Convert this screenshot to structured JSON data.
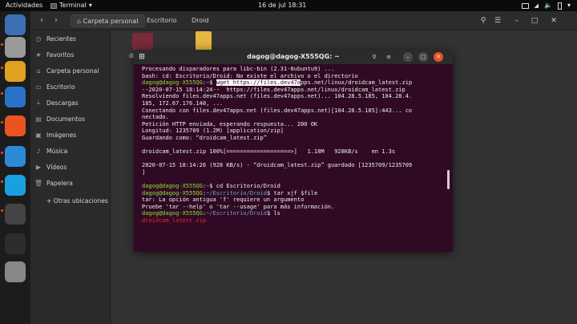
{
  "topbar": {
    "activities": "Actividades",
    "app": "Terminal",
    "clock": "16 de jul  18:31"
  },
  "dock": {
    "items": [
      {
        "name": "thunderbird-icon",
        "color": "#3d6fb5"
      },
      {
        "name": "files-icon",
        "color": "#9a9a9a"
      },
      {
        "name": "rhythmbox-icon",
        "color": "#e0a020"
      },
      {
        "name": "libreoffice-writer-icon",
        "color": "#2a72c8"
      },
      {
        "name": "ubuntu-software-icon",
        "color": "#e95420"
      },
      {
        "name": "help-icon",
        "color": "#2c8ad6"
      },
      {
        "name": "skype-icon",
        "color": "#1a9fe0"
      },
      {
        "name": "webcam-icon",
        "color": "#444444"
      },
      {
        "name": "terminal-icon",
        "color": "#2d2d2d"
      },
      {
        "name": "drive-icon",
        "color": "#888888"
      }
    ]
  },
  "fileManager": {
    "breadcrumbs": [
      "Carpeta personal",
      "Escritorio",
      "Droid"
    ],
    "sidebar": [
      "Recientes",
      "Favoritos",
      "Carpeta personal",
      "Escritorio",
      "Descargas",
      "Documentos",
      "Imágenes",
      "Música",
      "Vídeos",
      "Papelera",
      "+ Otras ubicaciones"
    ],
    "items": [
      {
        "label": "droi"
      }
    ]
  },
  "terminal": {
    "title": "dagog@dagog-X555QG: ~",
    "lines": [
      {
        "parts": [
          {
            "t": "Procesando disparadores para libc-bin (2.31-0ubuntu9) ..."
          }
        ]
      },
      {
        "parts": [
          {
            "t": "bash: cd: Escritorio/Droid: No existe el archivo o el directorio"
          }
        ]
      },
      {
        "parts": [
          {
            "t": "dagog@dagog-X555QG",
            "c": "pu"
          },
          {
            "t": ":"
          },
          {
            "t": "~",
            "c": "pp"
          },
          {
            "t": "$ "
          },
          {
            "t": "wget https://files.dev47a",
            "c": "hl"
          },
          {
            "t": "pps.net/linux/droidcam_latest.zip"
          }
        ]
      },
      {
        "parts": [
          {
            "t": "--2020-07-15 18:14:24--  https://files.dev47apps.net/linux/droidcam_latest.zip"
          }
        ]
      },
      {
        "parts": [
          {
            "t": "Resolviendo files.dev47apps.net (files.dev47apps.net)... 104.28.5.185, 104.28.4."
          }
        ]
      },
      {
        "parts": [
          {
            "t": "185, 172.67.176.140, ..."
          }
        ]
      },
      {
        "parts": [
          {
            "t": "Conectando con files.dev47apps.net (files.dev47apps.net)[104.28.5.185]:443... co"
          }
        ]
      },
      {
        "parts": [
          {
            "t": "nectado."
          }
        ]
      },
      {
        "parts": [
          {
            "t": "Petición HTTP enviada, esperando respuesta... 200 OK"
          }
        ]
      },
      {
        "parts": [
          {
            "t": "Longitud: 1235709 (1.2M) [application/zip]"
          }
        ]
      },
      {
        "parts": [
          {
            "t": "Guardando como: “droidcam_latest.zip”"
          }
        ]
      },
      {
        "parts": [
          {
            "t": ""
          }
        ]
      },
      {
        "parts": [
          {
            "t": "droidcam_latest.zip 100%[===================>]   1.18M   928KB/s    en 1.3s"
          }
        ]
      },
      {
        "parts": [
          {
            "t": ""
          }
        ]
      },
      {
        "parts": [
          {
            "t": "2020-07-15 18:14:26 (928 KB/s) - “droidcam_latest.zip” guardado [1235709/1235709"
          }
        ]
      },
      {
        "parts": [
          {
            "t": "]"
          }
        ]
      },
      {
        "parts": [
          {
            "t": ""
          }
        ]
      },
      {
        "parts": [
          {
            "t": "dagog@dagog-X555QG",
            "c": "pu"
          },
          {
            "t": ":"
          },
          {
            "t": "~",
            "c": "pp"
          },
          {
            "t": "$ cd Escritorio/Droid"
          }
        ]
      },
      {
        "parts": [
          {
            "t": "dagog@dagog-X555QG",
            "c": "pu"
          },
          {
            "t": ":"
          },
          {
            "t": "~/Escritorio/Droid",
            "c": "pp"
          },
          {
            "t": "$ tar xjf $file"
          }
        ]
      },
      {
        "parts": [
          {
            "t": "tar: La opción antigua 'f' requiere un argumento"
          }
        ]
      },
      {
        "parts": [
          {
            "t": "Pruebe 'tar --help' o 'tar --usage' para más información."
          }
        ]
      },
      {
        "parts": [
          {
            "t": "dagog@dagog-X555QG",
            "c": "pu"
          },
          {
            "t": ":"
          },
          {
            "t": "~/Escritorio/Droid",
            "c": "pp"
          },
          {
            "t": "$ ls"
          }
        ]
      },
      {
        "parts": [
          {
            "t": "droidcam_latest.zip",
            "c": "err"
          }
        ]
      }
    ]
  }
}
